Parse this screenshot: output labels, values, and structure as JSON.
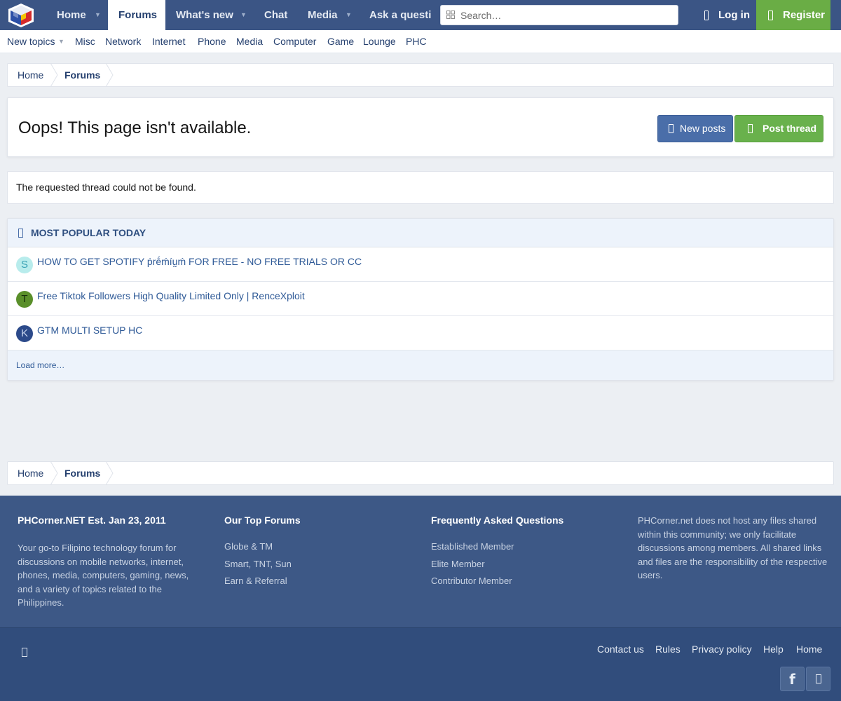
{
  "nav": {
    "tabs": [
      {
        "label": "Home"
      },
      {
        "label": "Forums"
      },
      {
        "label": "What's new"
      },
      {
        "label": "Chat"
      },
      {
        "label": "Media"
      },
      {
        "label": "Ask a questi"
      }
    ],
    "search_placeholder": "Search…",
    "login_label": "Log in",
    "register_label": "Register"
  },
  "subnav": {
    "items": [
      {
        "label": "New topics"
      },
      {
        "label": "Misc"
      },
      {
        "label": "Network"
      },
      {
        "label": "Internet"
      },
      {
        "label": "Phone"
      },
      {
        "label": "Media"
      },
      {
        "label": "Computer"
      },
      {
        "label": "Game"
      },
      {
        "label": "Lounge"
      },
      {
        "label": "PHC"
      }
    ]
  },
  "breadcrumb": {
    "items": [
      {
        "label": "Home"
      },
      {
        "label": "Forums"
      }
    ]
  },
  "page": {
    "title": "Oops! This page isn't available.",
    "new_posts_label": "New posts",
    "post_thread_label": "Post thread",
    "error_message": "The requested thread could not be found."
  },
  "popular": {
    "heading": "MOST POPULAR TODAY",
    "items": [
      {
        "avatar_letter": "S",
        "avatar_bg": "#b8ecec",
        "avatar_fg": "#39a2b5",
        "title": "HOW TO GET SPOTIFY ṗrḗḿíṵḿ FOR FREE - NO FREE TRIALS OR CC"
      },
      {
        "avatar_letter": "T",
        "avatar_bg": "#5a8f2a",
        "avatar_fg": "#17300a",
        "title": "Free Tiktok Followers High Quality Limited Only | RenceXploit"
      },
      {
        "avatar_letter": "K",
        "avatar_bg": "#2c4a8a",
        "avatar_fg": "#c7d4ee",
        "title": "GTM MULTI SETUP HC"
      }
    ],
    "load_more_label": "Load more…"
  },
  "footer": {
    "col1": {
      "heading": "PHCorner.NET Est. Jan 23, 2011",
      "text": "Your go-to Filipino technology forum for discussions on mobile networks, internet, phones, media, computers, gaming, news, and a variety of topics related to the Philippines."
    },
    "col2": {
      "heading": "Our Top Forums",
      "links": [
        {
          "label": "Globe & TM"
        },
        {
          "label": "Smart, TNT, Sun"
        },
        {
          "label": "Earn & Referral"
        }
      ]
    },
    "col3": {
      "heading": "Frequently Asked Questions",
      "links": [
        {
          "label": "Established Member"
        },
        {
          "label": "Elite Member"
        },
        {
          "label": "Contributor Member"
        }
      ]
    },
    "col4": {
      "text": "PHCorner.net does not host any files shared within this community; we only facilitate discussions among members. All shared links and files are the responsibility of the respective users."
    },
    "bottom_links": [
      {
        "label": "Contact us"
      },
      {
        "label": "Rules"
      },
      {
        "label": "Privacy policy"
      },
      {
        "label": "Help"
      },
      {
        "label": "Home"
      }
    ],
    "facebook_glyph": "f"
  },
  "colors": {
    "nav_bg": "#3b5585",
    "accent_blue": "#4a6ea9",
    "accent_green": "#69b14c",
    "link": "#2f5a97",
    "footer_bg": "#3d5886"
  }
}
